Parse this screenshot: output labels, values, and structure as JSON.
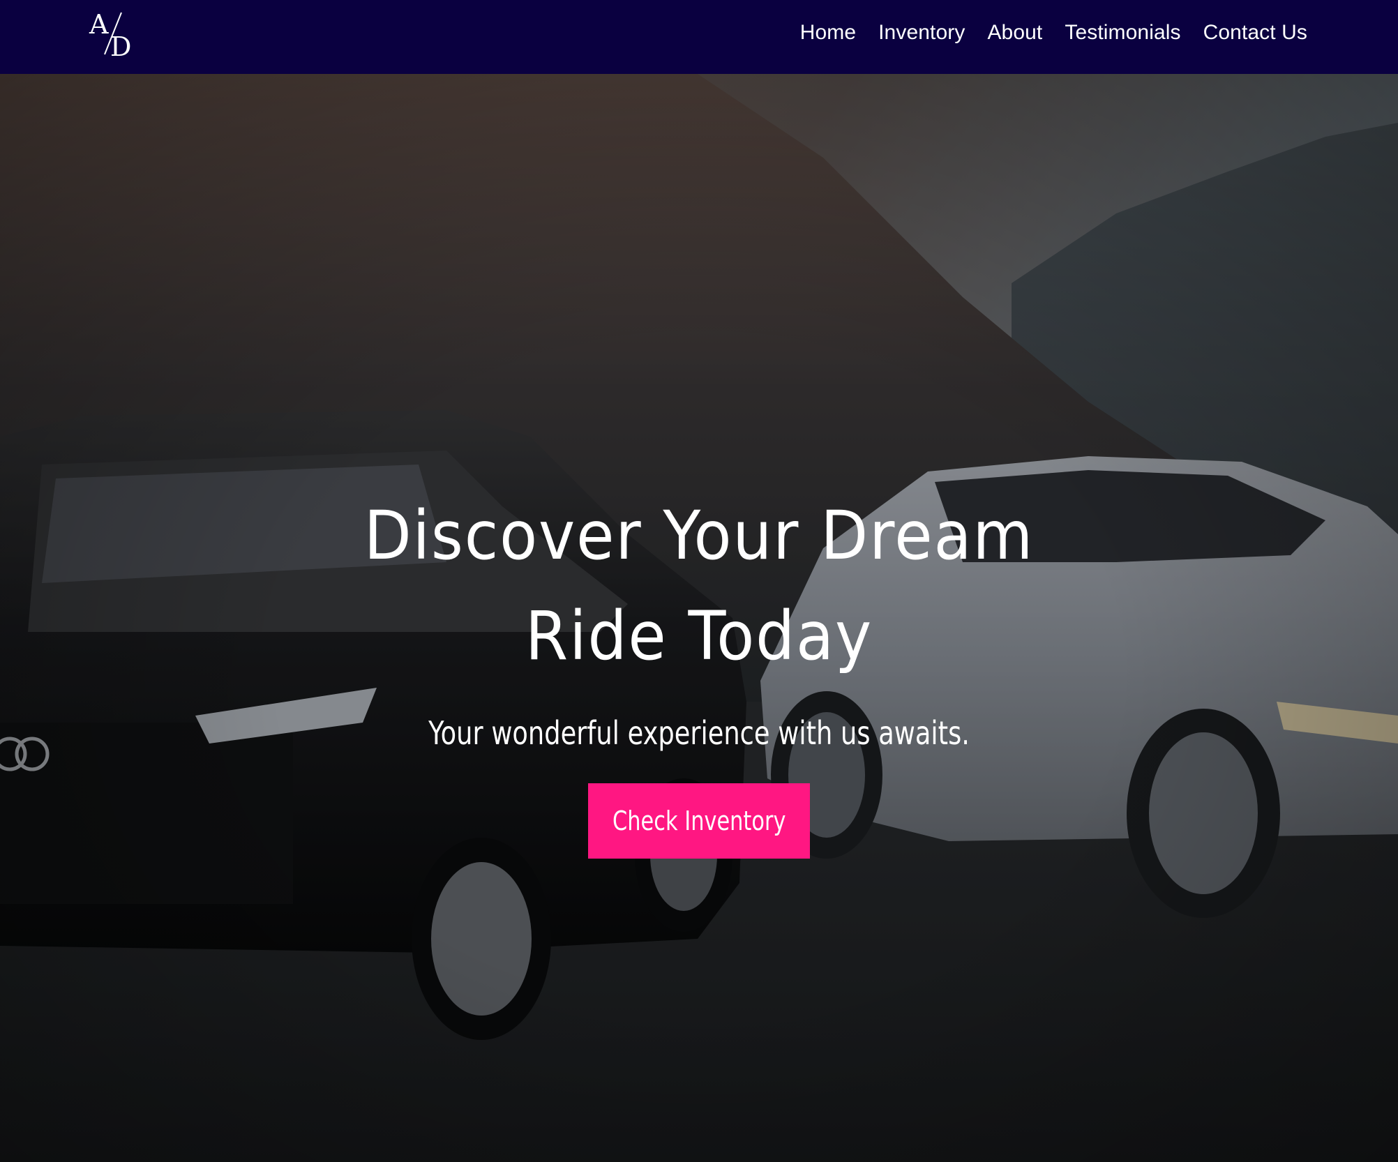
{
  "brand": {
    "logo_letter_top": "A",
    "logo_letter_bottom": "D",
    "logo_color": "#ffffff"
  },
  "nav": {
    "background": "#0a0040",
    "items": [
      {
        "label": "Home"
      },
      {
        "label": "Inventory"
      },
      {
        "label": "About"
      },
      {
        "label": "Testimonials"
      },
      {
        "label": "Contact Us"
      }
    ]
  },
  "hero": {
    "title_line1": "Discover Your Dream",
    "title_line2": "Ride Today",
    "subtitle": "Your wonderful experience with us awaits.",
    "cta_label": "Check Inventory",
    "cta_color": "#ff1782",
    "background_image": "photo-two-cars-mountains"
  }
}
